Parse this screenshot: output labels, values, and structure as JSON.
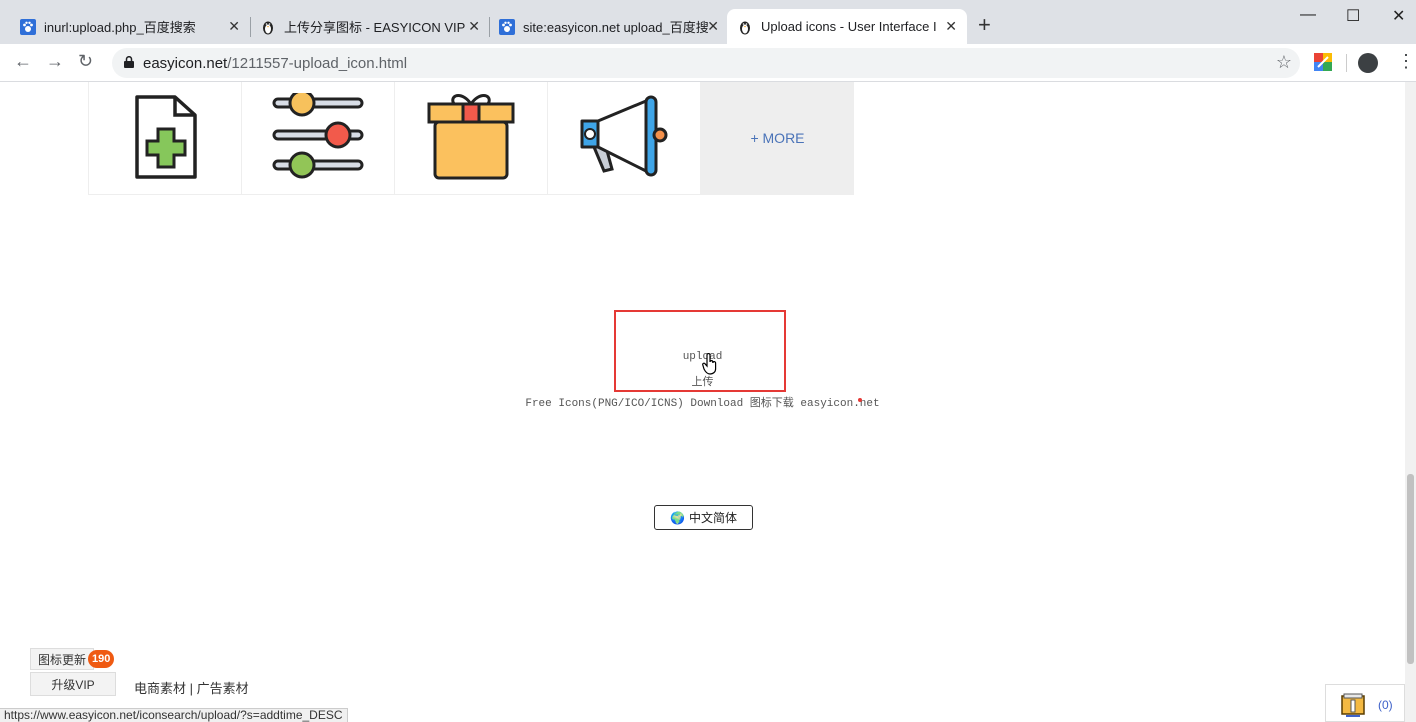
{
  "browser": {
    "tabs": [
      {
        "title": "inurl:upload.php_百度搜索",
        "favicon": "baidu-paw-icon",
        "active": false
      },
      {
        "title": "上传分享图标 - EASYICON VIP",
        "favicon": "penguin-icon",
        "active": false
      },
      {
        "title": "site:easyicon.net upload_百度搜",
        "favicon": "baidu-paw-icon",
        "active": false
      },
      {
        "title": "Upload icons - User Interface I",
        "favicon": "penguin-icon",
        "active": true
      }
    ],
    "new_tab_icon": "+",
    "url_domain": "easyicon.net",
    "url_path": "/1211557-upload_icon.html"
  },
  "page": {
    "more_label": "+ MORE",
    "icon_name_en": "upload",
    "icon_name_cn": "上传",
    "tagline": "Free Icons(PNG/ICO/ICNS) Download 图标下载 easyicon.net",
    "language_button": "中文简体",
    "update_label": "图标更新",
    "update_count": "190",
    "vip_label": "升级VIP",
    "footer_links": "电商素材 | 广告素材",
    "download_count": "(0)"
  },
  "status_bar": "https://www.easyicon.net/iconsearch/upload/?s=addtime_DESC",
  "colors": {
    "highlight_box": "#e53935",
    "badge": "#ef5a12",
    "more_link": "#4a73b8"
  }
}
